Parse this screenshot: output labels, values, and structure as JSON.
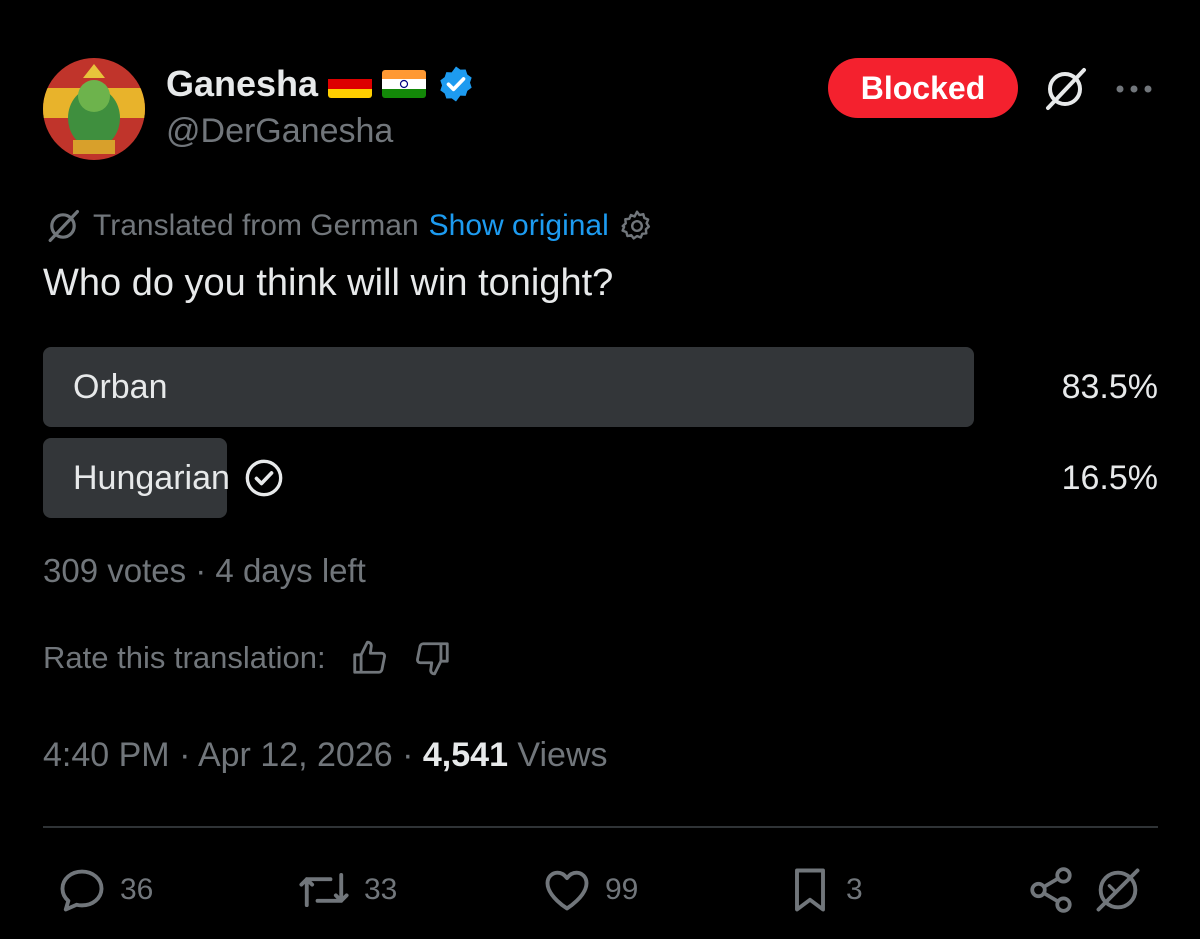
{
  "author": {
    "display_name": "Ganesha",
    "handle": "@DerGanesha",
    "verified": true,
    "flags": [
      "germany",
      "india"
    ],
    "avatar_icon": "ganesha-avatar"
  },
  "header": {
    "blocked_label": "Blocked"
  },
  "translation": {
    "label": "Translated from German",
    "show_original": "Show original"
  },
  "tweet": {
    "text": "Who do you think will win tonight?"
  },
  "poll": {
    "options": [
      {
        "label": "Orban",
        "percent_text": "83.5%",
        "percent": 83.5,
        "selected": false
      },
      {
        "label": "Hungarian",
        "percent_text": "16.5%",
        "percent": 16.5,
        "selected": true
      }
    ],
    "meta": "309 votes · 4 days left"
  },
  "rate": {
    "label": "Rate this translation:"
  },
  "timestamp": {
    "time": "4:40 PM · Apr 12, 2026 · ",
    "views_count": "4,541",
    "views_label": " Views"
  },
  "actions": {
    "replies": "36",
    "reposts": "33",
    "likes": "99",
    "bookmarks": "3"
  },
  "colors": {
    "background": "#000000",
    "text": "#e7e9ea",
    "muted": "#71767b",
    "link": "#1d9bf0",
    "blocked": "#f4212e",
    "poll_fill": "#333639"
  }
}
